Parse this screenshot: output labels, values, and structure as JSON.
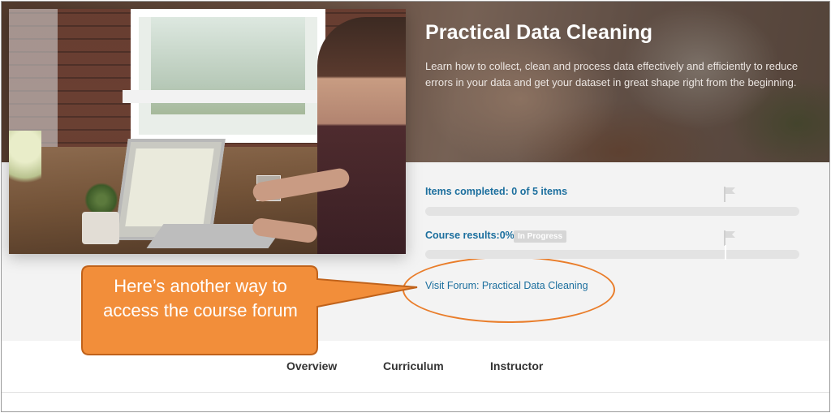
{
  "course": {
    "title": "Practical Data Cleaning",
    "description": "Learn how to collect, clean and process data effectively and efficiently to reduce errors in your data and get your dataset in great shape right from the beginning."
  },
  "progress": {
    "items_label": "Items completed: 0 of 5 items",
    "items_completed_fraction": 0,
    "results_label": "Course results:0%",
    "results_fraction": 0,
    "status_badge": "In Progress"
  },
  "forum": {
    "link_text": "Visit Forum: Practical Data Cleaning"
  },
  "callout": {
    "text": "Here’s another way to access the course forum",
    "color": "#F28E3A"
  },
  "tabs": [
    {
      "label": "Overview"
    },
    {
      "label": "Curriculum"
    },
    {
      "label": "Instructor"
    }
  ],
  "icons": {
    "flag": "flag-icon"
  },
  "colors": {
    "link": "#1C6F9E",
    "highlight": "#E97D2A"
  }
}
